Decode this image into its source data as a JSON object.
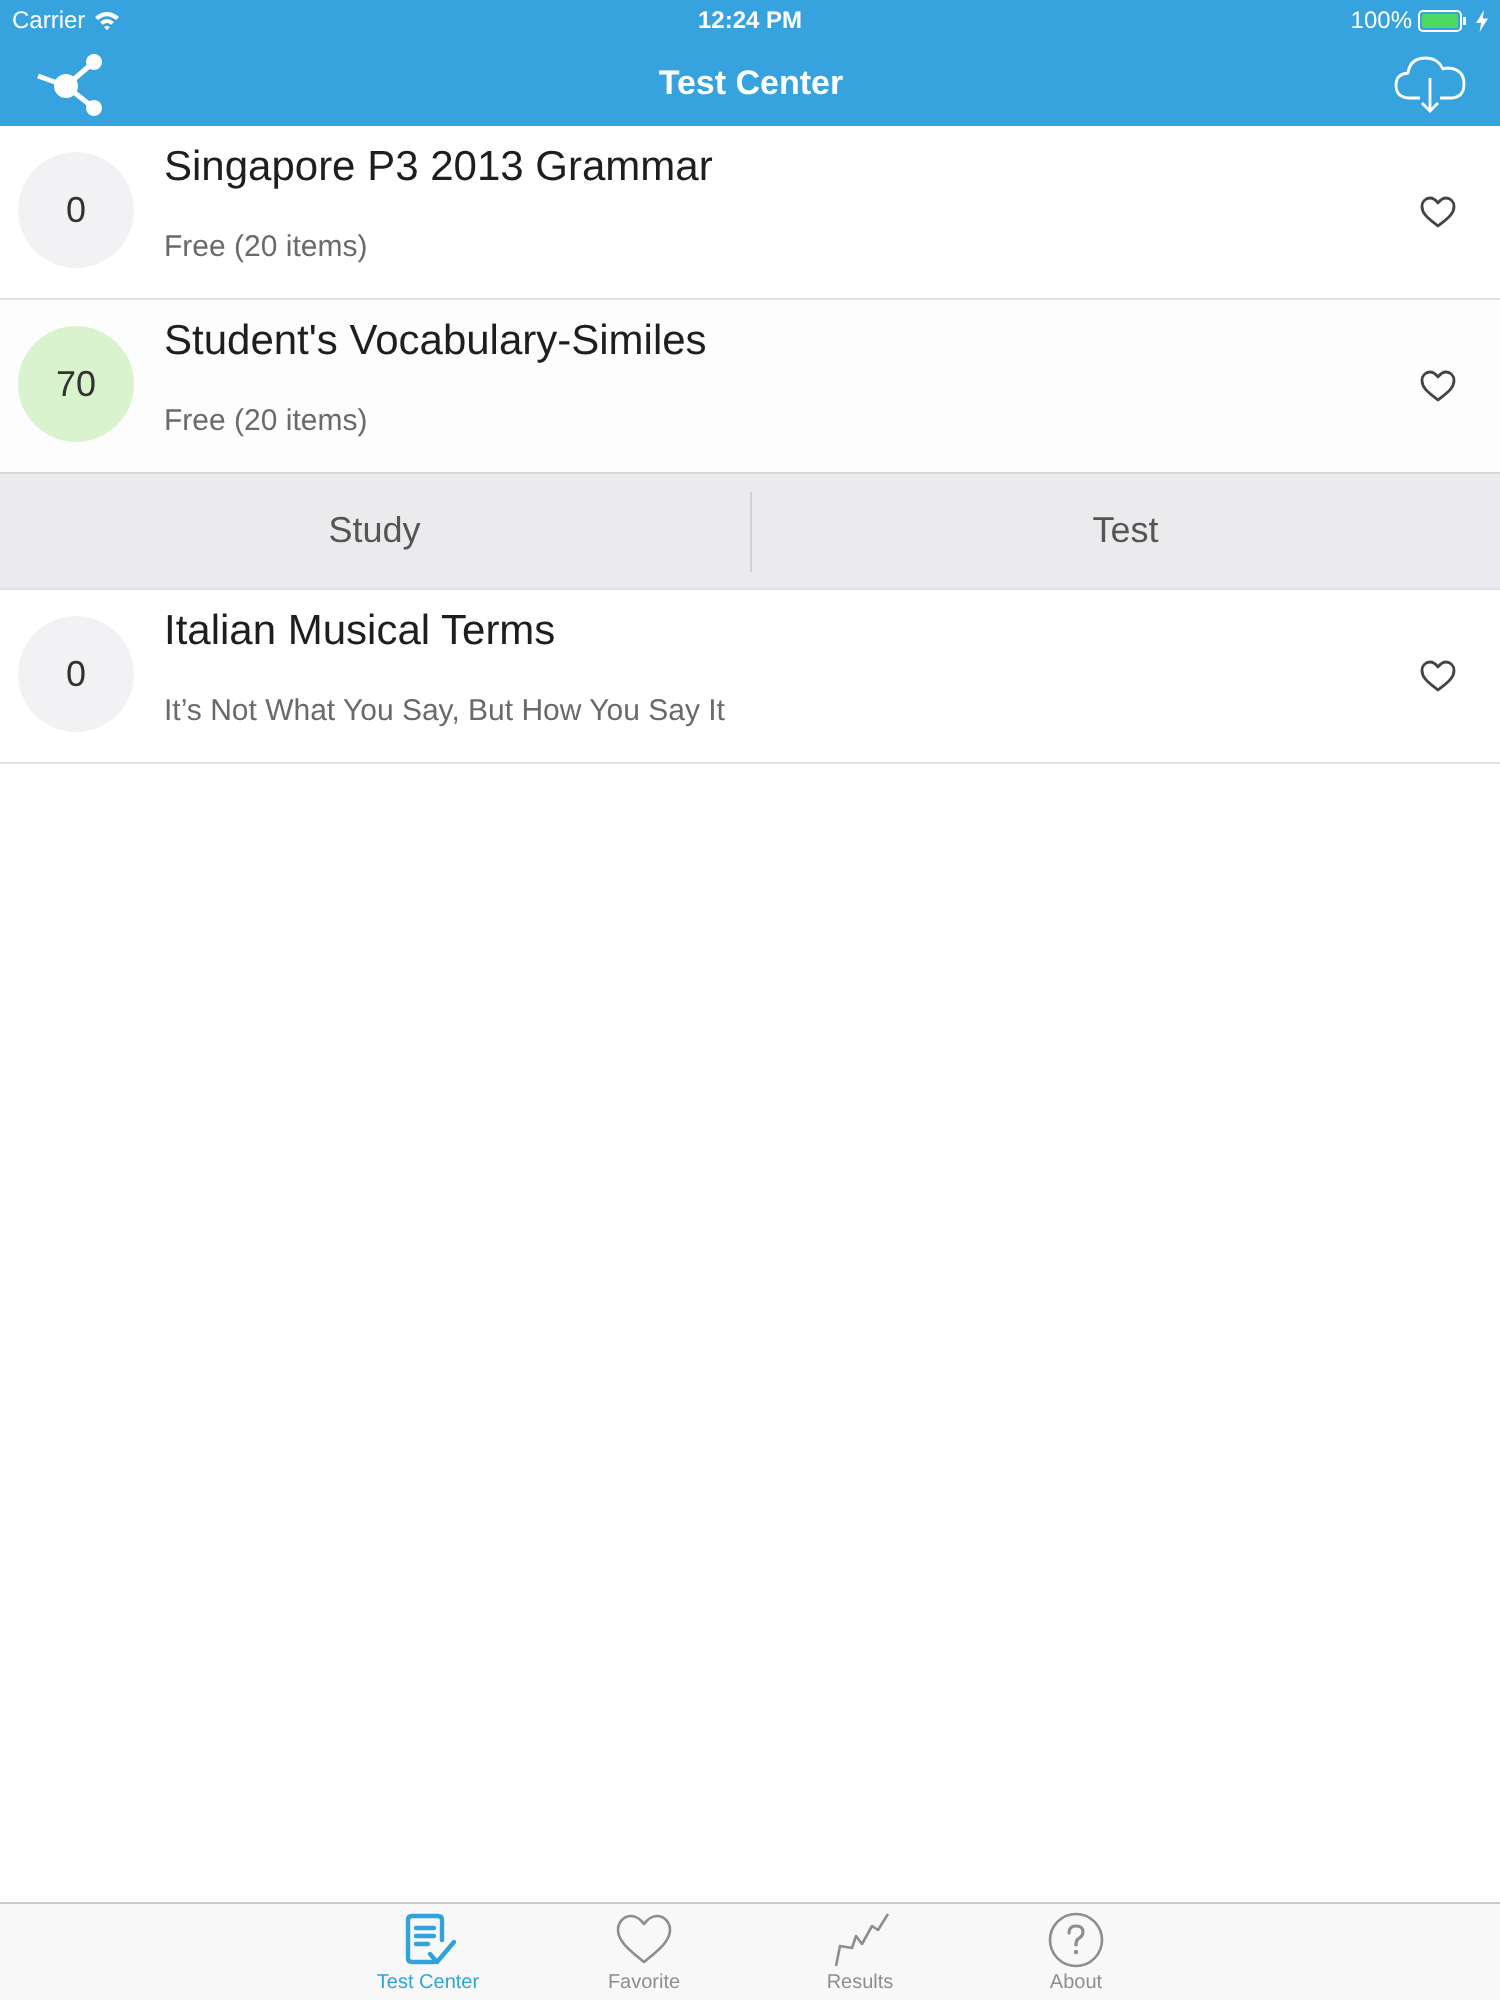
{
  "status_bar": {
    "carrier": "Carrier",
    "time": "12:24 PM",
    "battery": "100%",
    "charging": true
  },
  "nav_bar": {
    "title": "Test Center"
  },
  "tests": [
    {
      "score": "0",
      "color": "#f2f2f4",
      "title": "Singapore P3 2013 Grammar",
      "subtitle": "Free (20 items)",
      "favorited": false,
      "expanded": false
    },
    {
      "score": "70",
      "color": "#d9f3cf",
      "title": "Student's Vocabulary-Similes",
      "subtitle": "Free (20 items)",
      "favorited": false,
      "expanded": true,
      "actions": [
        "Study",
        "Test"
      ]
    },
    {
      "score": "0",
      "color": "#f2f2f4",
      "title": "Italian Musical Terms",
      "subtitle": "It’s Not What You Say, But How You Say It",
      "favorited": false,
      "expanded": false
    }
  ],
  "tabs": [
    {
      "kind": "test-center",
      "label": "Test Center",
      "selected": true
    },
    {
      "kind": "favorite",
      "label": "Favorite",
      "selected": false
    },
    {
      "kind": "results",
      "label": "Results",
      "selected": false
    },
    {
      "kind": "about",
      "label": "About",
      "selected": false
    }
  ]
}
